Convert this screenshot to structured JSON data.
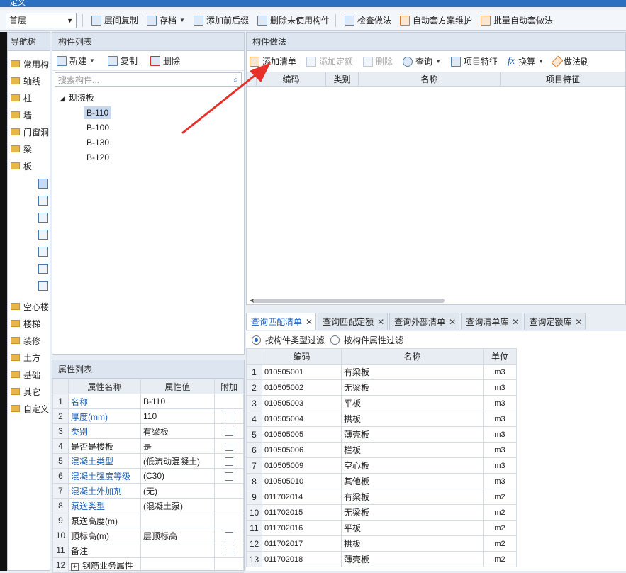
{
  "window": {
    "title": "定义"
  },
  "toolbar": {
    "floor": "首层",
    "items": [
      "层间复制",
      "存档",
      "添加前后缀",
      "删除未使用构件",
      "检查做法",
      "自动套方案维护",
      "批量自动套做法"
    ]
  },
  "nav": {
    "title": "导航树",
    "items": [
      "常用构",
      "轴线",
      "柱",
      "墙",
      "门窗洞",
      "梁",
      "板"
    ],
    "items2": [
      "空心楼",
      "楼梯",
      "装修",
      "土方",
      "基础",
      "其它",
      "自定义"
    ]
  },
  "complist": {
    "title": "构件列表",
    "new": "新建",
    "copy": "复制",
    "delete": "删除",
    "search_placeholder": "搜索构件...",
    "root": "现浇板",
    "leaves": [
      "B-110",
      "B-100",
      "B-130",
      "B-120"
    ]
  },
  "props": {
    "title": "属性列表",
    "h_name": "属性名称",
    "h_value": "属性值",
    "h_extra": "附加",
    "rows": [
      {
        "n": "1",
        "name": "名称",
        "value": "B-110"
      },
      {
        "n": "2",
        "name": "厚度(mm)",
        "value": "110"
      },
      {
        "n": "3",
        "name": "类别",
        "value": "有梁板"
      },
      {
        "n": "4",
        "name": "是否是楼板",
        "value": "是"
      },
      {
        "n": "5",
        "name": "混凝土类型",
        "value": "(低流动混凝土)"
      },
      {
        "n": "6",
        "name": "混凝土强度等级",
        "value": "(C30)"
      },
      {
        "n": "7",
        "name": "混凝土外加剂",
        "value": "(无)"
      },
      {
        "n": "8",
        "name": "泵送类型",
        "value": "(混凝土泵)"
      },
      {
        "n": "9",
        "name": "泵送高度(m)",
        "value": ""
      },
      {
        "n": "10",
        "name": "顶标高(m)",
        "value": "层顶标高"
      },
      {
        "n": "11",
        "name": "备注",
        "value": ""
      },
      {
        "n": "12",
        "name": "钢筋业务属性",
        "value": ""
      }
    ]
  },
  "method": {
    "title": "构件做法",
    "add_list": "添加清单",
    "add_quota": "添加定额",
    "delete": "删除",
    "query": "查询",
    "item_feature": "项目特征",
    "convert": "换算",
    "brush": "做法刷",
    "h_code": "编码",
    "h_type": "类别",
    "h_name": "名称",
    "h_feature": "项目特征"
  },
  "tabs": [
    "查询匹配清单",
    "查询匹配定额",
    "查询外部清单",
    "查询清单库",
    "查询定额库"
  ],
  "filter": {
    "opt1": "按构件类型过滤",
    "opt2": "按构件属性过滤"
  },
  "result": {
    "h_code": "编码",
    "h_name": "名称",
    "h_unit": "单位",
    "rows": [
      {
        "n": "1",
        "code": "010505001",
        "name": "有梁板",
        "unit": "m3"
      },
      {
        "n": "2",
        "code": "010505002",
        "name": "无梁板",
        "unit": "m3"
      },
      {
        "n": "3",
        "code": "010505003",
        "name": "平板",
        "unit": "m3"
      },
      {
        "n": "4",
        "code": "010505004",
        "name": "拱板",
        "unit": "m3"
      },
      {
        "n": "5",
        "code": "010505005",
        "name": "薄壳板",
        "unit": "m3"
      },
      {
        "n": "6",
        "code": "010505006",
        "name": "栏板",
        "unit": "m3"
      },
      {
        "n": "7",
        "code": "010505009",
        "name": "空心板",
        "unit": "m3"
      },
      {
        "n": "8",
        "code": "010505010",
        "name": "其他板",
        "unit": "m3"
      },
      {
        "n": "9",
        "code": "011702014",
        "name": "有梁板",
        "unit": "m2"
      },
      {
        "n": "10",
        "code": "011702015",
        "name": "无梁板",
        "unit": "m2"
      },
      {
        "n": "11",
        "code": "011702016",
        "name": "平板",
        "unit": "m2"
      },
      {
        "n": "12",
        "code": "011702017",
        "name": "拱板",
        "unit": "m2"
      },
      {
        "n": "13",
        "code": "011702018",
        "name": "薄壳板",
        "unit": "m2"
      }
    ]
  },
  "colors": {
    "accent": "#1e5fbf",
    "titlebar": "#2b6fc0",
    "arrow": "#e8302a",
    "selection": "#c7d8ef"
  }
}
